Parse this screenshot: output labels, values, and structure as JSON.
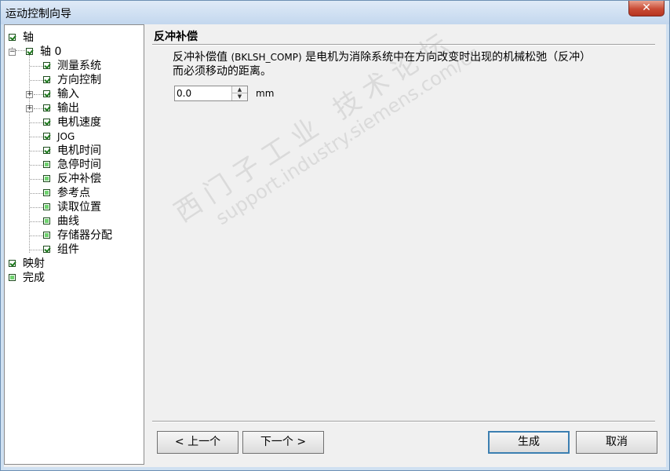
{
  "window": {
    "title": "运动控制向导",
    "close_glyph": "✕"
  },
  "tree": {
    "items": [
      {
        "label": "轴",
        "checked": true
      },
      {
        "label": "轴 0",
        "checked": true,
        "expander": "−"
      },
      {
        "label": "测量系统",
        "checked": true
      },
      {
        "label": "方向控制",
        "checked": true
      },
      {
        "label": "输入",
        "checked": true,
        "expander": "+"
      },
      {
        "label": "输出",
        "checked": true,
        "expander": "+"
      },
      {
        "label": "电机速度",
        "checked": true
      },
      {
        "label": "JOG",
        "checked": true
      },
      {
        "label": "电机时间",
        "checked": true
      },
      {
        "label": "急停时间",
        "checked": false
      },
      {
        "label": "反冲补偿",
        "checked": false
      },
      {
        "label": "参考点",
        "checked": false
      },
      {
        "label": "读取位置",
        "checked": false
      },
      {
        "label": "曲线",
        "checked": false
      },
      {
        "label": "存储器分配",
        "checked": false
      },
      {
        "label": "组件",
        "checked": true
      },
      {
        "label": "映射",
        "checked": true
      },
      {
        "label": "完成",
        "checked": false
      }
    ]
  },
  "panel": {
    "title": "反冲补偿",
    "description_part1": "反冲补偿值 ",
    "description_code": "(BKLSH_COMP)",
    "description_part2": " 是电机为消除系统中在方向改变时出现的机械松弛（反冲）而必须移动的距离。",
    "backlash_value": "0.0",
    "unit": "mm"
  },
  "buttons": {
    "prev": "< 上一个",
    "next": "下一个 >",
    "generate": "生成",
    "cancel": "取消"
  },
  "watermark": {
    "line1": "西门子工业 技术论坛",
    "line2": "support.industry.siemens.com/cs"
  }
}
